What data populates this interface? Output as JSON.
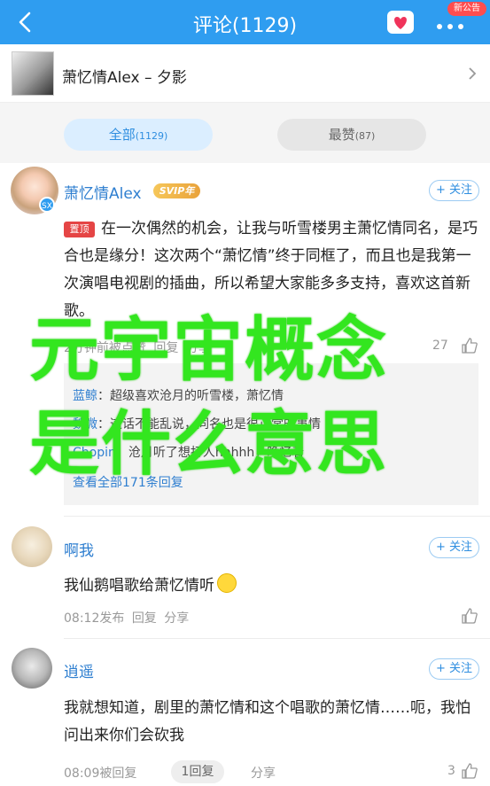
{
  "header": {
    "title": "评论(1129)",
    "badge": "新公告",
    "accent_color": "#2f9df0"
  },
  "song": {
    "name": "萧忆情Alex – 夕影"
  },
  "filter_tabs": [
    {
      "label": "全部",
      "count": "(1129)",
      "active": true
    },
    {
      "label": "最赞",
      "count": "(87)",
      "active": false
    }
  ],
  "comments": [
    {
      "user": "萧忆情Alex",
      "vip": "SVIP年",
      "avatar_badge": "SX",
      "follow": "+ 关注",
      "pinned_label": "置顶",
      "text": "在一次偶然的机会，让我与听雪楼男主萧忆情同名，是巧合也是缘分！这次两个“萧忆情”终于同框了，而且也是我第一次演唱电视剧的插曲，所以希望大家能多多支持，喜欢这首新歌。",
      "time": "2分钟前被点赞",
      "reply": "回复",
      "share": "分享",
      "likes": "27",
      "replies_preview": [
        {
          "user": "蓝鲸",
          "text": "超级喜欢沧月的听雪楼，萧忆情"
        },
        {
          "user": "魏微",
          "text": "这话不能乱说，同名也是很正常的事情"
        },
        {
          "user": "Chopin",
          "text": "沧月听了想打人hhhhh，晚忆着"
        }
      ],
      "view_all": "查看全部171条回复"
    },
    {
      "user": "啊我",
      "follow": "+ 关注",
      "text": "我仙鹅唱歌给萧忆情听",
      "time": "08:12发布",
      "reply": "回复",
      "share": "分享",
      "likes": ""
    },
    {
      "user": "逍遥",
      "follow": "+ 关注",
      "text": "我就想知道，剧里的萧忆情和这个唱歌的萧忆情……呃，我怕问出来你们会砍我",
      "time": "08:09被回复",
      "reply_count": "1回复",
      "share": "分享",
      "likes": "3"
    }
  ],
  "overlay": {
    "line1": "元宇宙概念",
    "line2": "是什么意思",
    "color": "#33e61f"
  }
}
